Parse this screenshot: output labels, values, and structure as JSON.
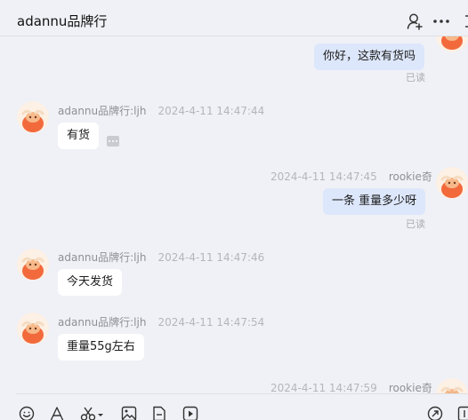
{
  "header": {
    "title": "adannu品牌行"
  },
  "messages": [
    {
      "direction": "out",
      "text": "你好，这款有货吗",
      "status": "已读"
    },
    {
      "direction": "in",
      "sender": "adannu品牌行:ljh",
      "time": "2024-4-11 14:47:44",
      "text": "有货"
    },
    {
      "direction": "out",
      "sender": "rookie奇",
      "time": "2024-4-11 14:47:45",
      "text": "一条 重量多少呀",
      "status": "已读"
    },
    {
      "direction": "in",
      "sender": "adannu品牌行:ljh",
      "time": "2024-4-11 14:47:46",
      "text": "今天发货"
    },
    {
      "direction": "in",
      "sender": "adannu品牌行:ljh",
      "time": "2024-4-11 14:47:54",
      "text": "重量55g左右"
    },
    {
      "direction": "out",
      "sender": "rookie奇",
      "time": "2024-4-11 14:47:59"
    }
  ],
  "icons": {
    "header": [
      "add-contact-icon",
      "more-icon",
      "sidebar-toggle-icon"
    ],
    "toolbar": [
      "emoji-icon",
      "font-icon",
      "screenshot-icon",
      "image-icon",
      "file-icon",
      "video-icon",
      "history-icon",
      "expand-icon"
    ]
  },
  "colors": {
    "background": "#f0f1f6",
    "bubble_in": "#ffffff",
    "bubble_out": "#dde7fb",
    "avatar_orange": "#f26a3c"
  }
}
